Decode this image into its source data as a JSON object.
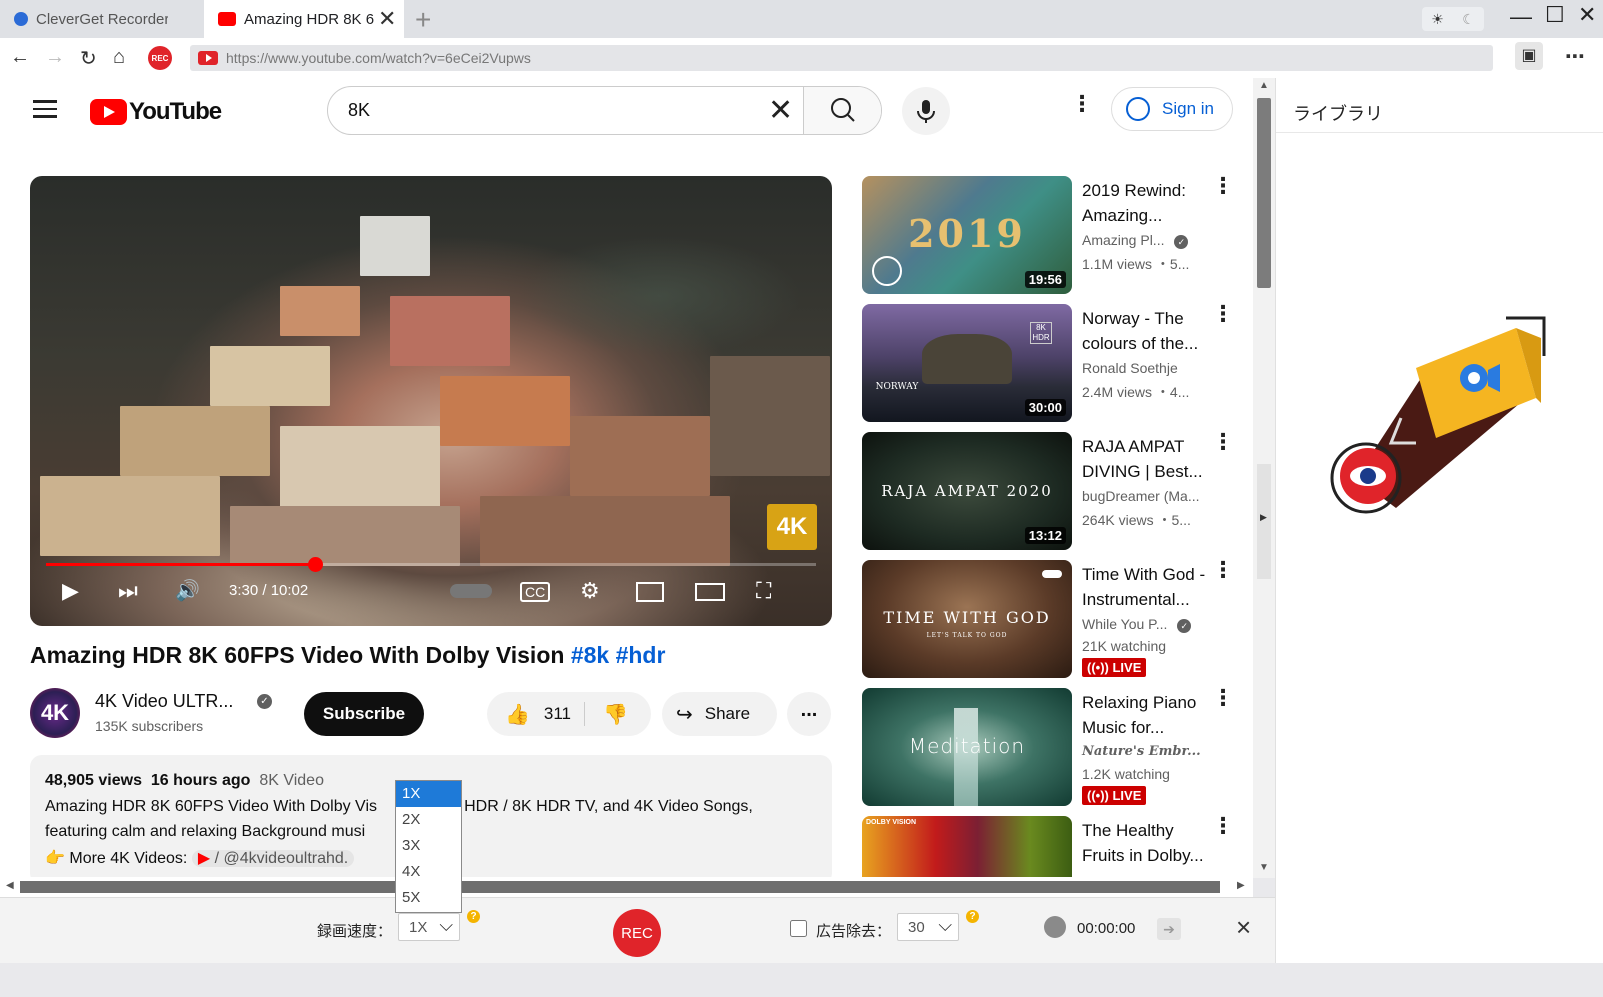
{
  "browser": {
    "tabs": [
      {
        "label": "CleverGet Recorder",
        "active": false
      },
      {
        "label": "Amazing HDR 8K 6",
        "active": true
      }
    ],
    "new_tab": "+",
    "url": "https://www.youtube.com/watch?v=6eCei2Vupws",
    "rec_badge": "REC"
  },
  "youtube": {
    "logo_text": "YouTube",
    "search_query": "8K",
    "sign_in": "Sign in"
  },
  "video": {
    "time": "3:30 / 10:02",
    "progress": 0.349,
    "badge": "4K",
    "title": "Amazing HDR 8K 60FPS Video With Dolby Vision",
    "hashtags": "#8k #hdr",
    "channel": "4K Video ULTR...",
    "avatar_text": "4K",
    "subscribers": "135K subscribers",
    "subscribe": "Subscribe",
    "likes": "311",
    "share": "Share",
    "more": "...",
    "views": "48,905 views",
    "uploaded": "16 hours ago",
    "category": "8K Video",
    "desc_line1_a": "Amazing HDR 8K 60FPS Video With Dolby Vis",
    "desc_line1_b": "K HDR / 8K HDR TV, and 4K Video Songs,",
    "desc_line2": "featuring calm and relaxing Background musi",
    "desc_line3_prefix": "More 4K Videos:",
    "desc_line3_link": "/ @4kvideoultrahd."
  },
  "related": [
    {
      "title": "2019 Rewind: Amazing...",
      "channel": "Amazing Pl...",
      "meta": "1.1M views ・5...",
      "duration": "19:56",
      "thumb_text": "2019",
      "verified": true
    },
    {
      "title": "Norway - The colours of the...",
      "channel": "Ronald Soethje",
      "meta": "2.4M views ・4...",
      "duration": "30:00",
      "thumb_text": "NORWAY",
      "thumb_badge": "8K HDR"
    },
    {
      "title": "RAJA AMPAT DIVING | Best...",
      "channel": "bugDreamer (Ma...",
      "meta": "264K views ・5...",
      "duration": "13:12",
      "thumb_text": "RAJA AMPAT 2020"
    },
    {
      "title": "Time With God - Instrumental...",
      "channel": "While You P...",
      "meta": "21K watching",
      "live": "LIVE",
      "thumb_text": "TIME WITH GOD",
      "thumb_sub": "LET'S TALK TO GOD",
      "verified": true
    },
    {
      "title": "Relaxing Piano Music for...",
      "channel": "Nature's Embr...",
      "meta": "1.2K watching",
      "live": "LIVE",
      "thumb_text": "Meditation"
    },
    {
      "title": "The Healthy Fruits in Dolby...",
      "thumb_badge": "DOLBY VISION"
    }
  ],
  "recorder": {
    "speed_label": "録画速度：",
    "speed_value": "1X",
    "speed_options": [
      "1X",
      "2X",
      "3X",
      "4X",
      "5X"
    ],
    "rec_button": "REC",
    "ad_remove_label": "広告除去：",
    "ad_value": "30",
    "timer": "00:00:00",
    "help": "?",
    "close": "×"
  },
  "panel": {
    "title": "ライブラリ"
  },
  "colors": {
    "youtube_red": "#ff0000",
    "link_blue": "#065fd4",
    "rec_red": "#e0242a",
    "dropdown_highlight": "#1e7ad8"
  }
}
